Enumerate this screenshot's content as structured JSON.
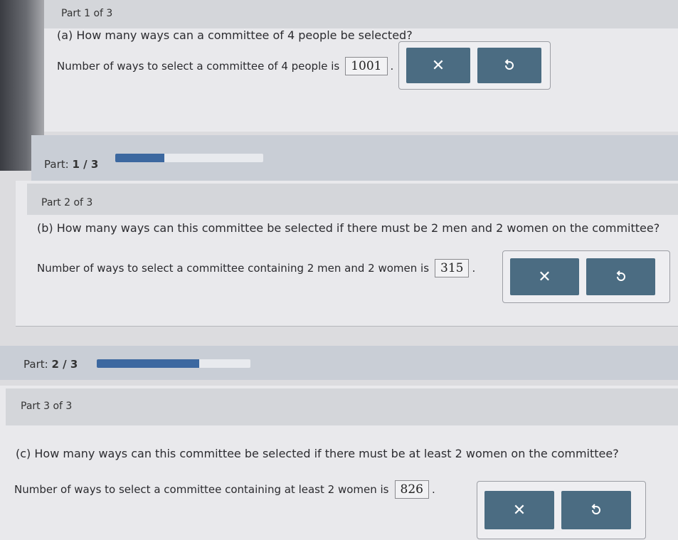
{
  "part1": {
    "header": "Part 1 of 3",
    "question": "(a) How many ways can a committee of 4 people be selected?",
    "answer_prefix": "Number of ways to select a committee of 4 people is",
    "answer_value": "1001",
    "answer_suffix": "."
  },
  "progress1": {
    "label": "Part:",
    "value": "1 / 3",
    "fraction": 0.333
  },
  "part2": {
    "header": "Part 2 of 3",
    "question": "(b) How many ways can this committee be selected if there must be 2 men and 2 women on the committee?",
    "answer_prefix": "Number of ways to select a committee containing 2 men and 2 women is",
    "answer_value": "315",
    "answer_suffix": "."
  },
  "progress2": {
    "label": "Part:",
    "value": "2 / 3",
    "fraction": 0.667
  },
  "part3": {
    "header": "Part 3 of 3",
    "question": "(c) How many ways can this committee be selected if there must be at least 2 women on the committee?",
    "answer_prefix": "Number of ways to select a committee containing at least 2 women is",
    "answer_value": "826",
    "answer_suffix": "."
  },
  "buttons": {
    "clear_icon": "x-icon",
    "undo_icon": "undo-icon"
  },
  "colors": {
    "button": "#4b6c82",
    "progress_fill": "#3c68a0"
  }
}
